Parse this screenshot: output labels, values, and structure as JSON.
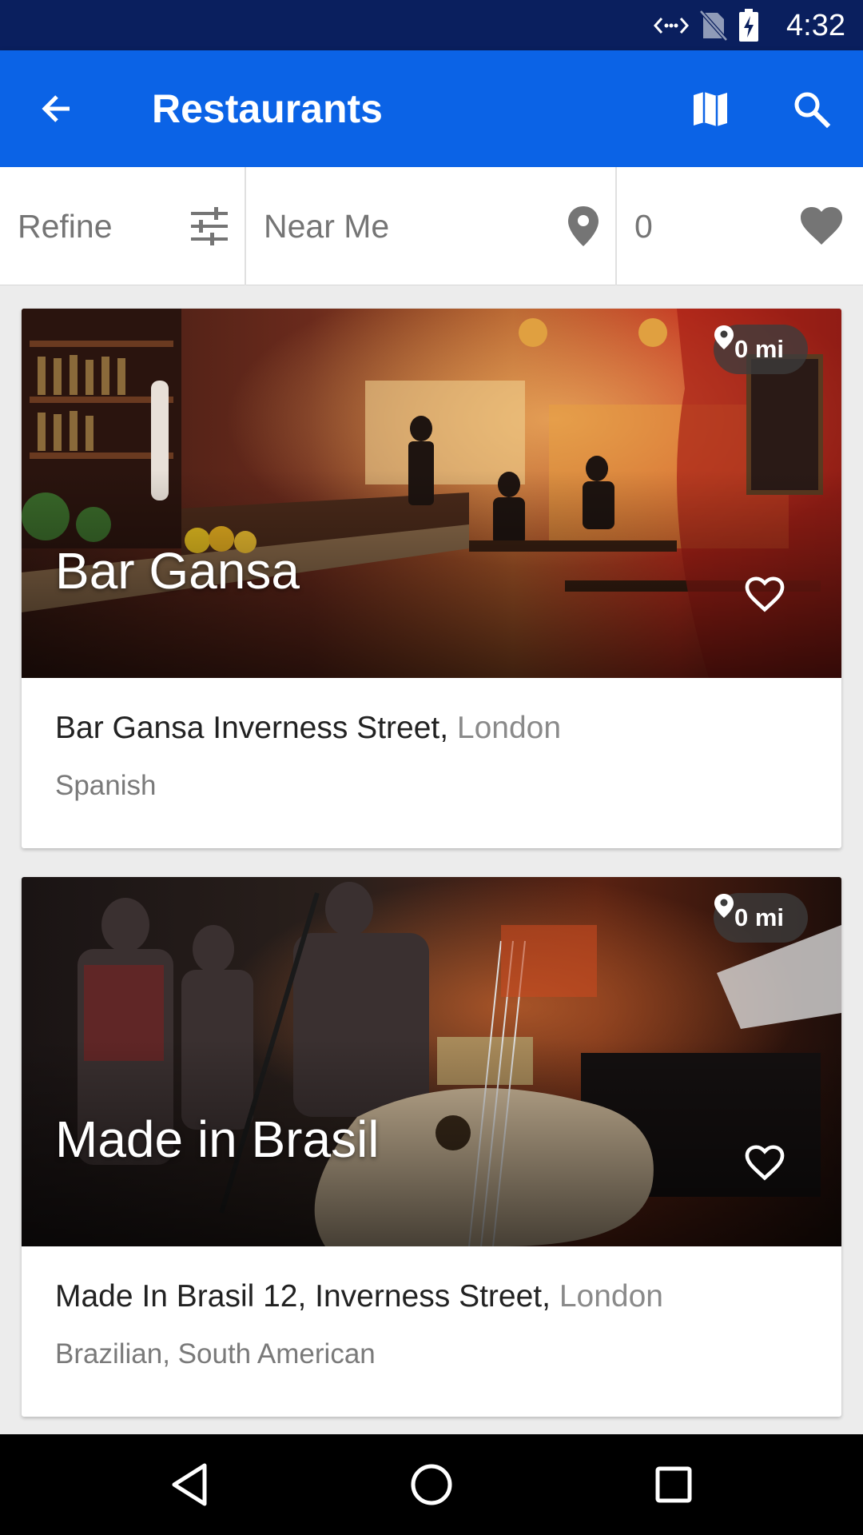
{
  "status_bar": {
    "time": "4:32",
    "icons": [
      "data-sync-icon",
      "no-sim-icon",
      "battery-charging-icon"
    ]
  },
  "app_bar": {
    "title": "Restaurants",
    "back_icon": "arrow-back-icon",
    "map_icon": "map-icon",
    "search_icon": "search-icon",
    "background_color": "#0b63e6"
  },
  "filter_bar": {
    "refine_label": "Refine",
    "near_me_label": "Near Me",
    "favorites_count": "0"
  },
  "restaurants": [
    {
      "name": "Bar Gansa",
      "distance": "0 mi",
      "address": "Bar Gansa Inverness Street,",
      "city": "London",
      "cuisine": "Spanish"
    },
    {
      "name": "Made in Brasil",
      "distance": "0 mi",
      "address": "Made In Brasil 12, Inverness Street,",
      "city": "London",
      "cuisine": "Brazilian, South American"
    }
  ],
  "nav_bar": {
    "icons": [
      "back-triangle-icon",
      "home-circle-icon",
      "recents-square-icon"
    ]
  }
}
